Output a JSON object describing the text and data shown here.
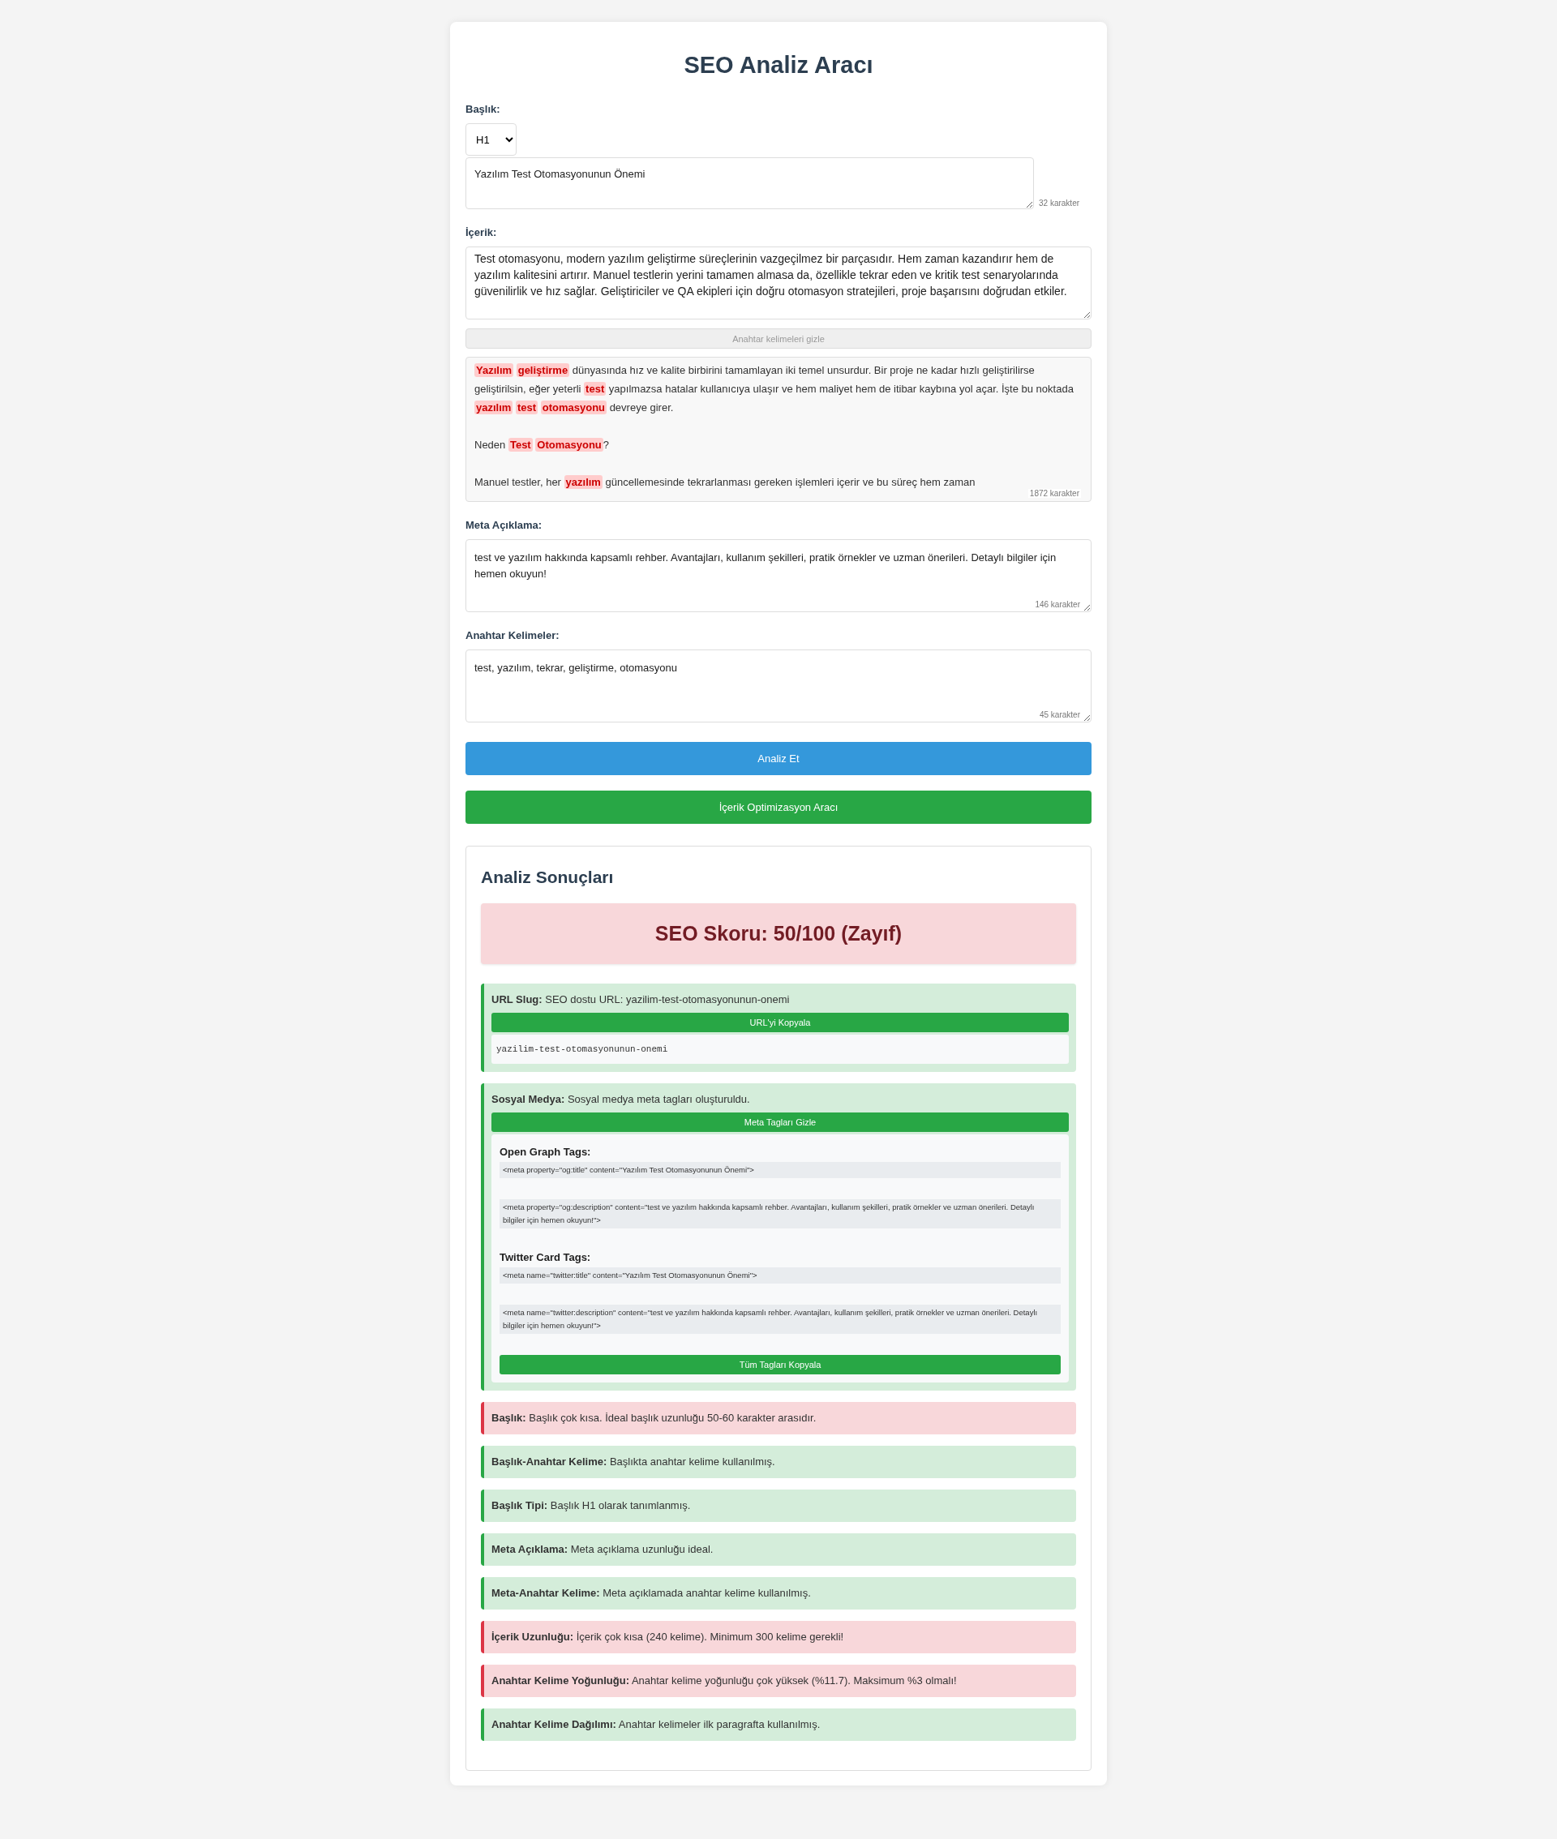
{
  "title": "SEO Analiz Aracı",
  "heading": {
    "label": "Başlık:",
    "level_select": "H1",
    "value": "Yazılım Test Otomasyonunun Önemi",
    "counter": "32 karakter"
  },
  "content": {
    "label": "İçerik:",
    "value": "Test otomasyonu, modern yazılım geliştirme süreçlerinin vazgeçilmez bir parçasıdır. Hem zaman kazandırır hem de yazılım kalitesini artırır. Manuel testlerin yerini tamamen almasa da, özellikle tekrar eden ve kritik test senaryolarında güvenilirlik ve hız sağlar. Geliştiriciler ve QA ekipleri için doğru otomasyon stratejileri, proje başarısını doğrudan etkiler.",
    "toggle_button": "Anahtar kelimeleri gizle",
    "preview": {
      "counter": "1872 karakter",
      "paragraphs": [
        [
          {
            "text": "Yazılım geliştirme",
            "highlighted": true
          },
          {
            "text": " dünyasında hız ve kalite birbirini tamamlayan iki temel unsurdur. Bir proje ne kadar hızlı geliştirilirse geliştirilsin, eğer yeterli ",
            "highlighted": false
          },
          {
            "text": "test",
            "highlighted": true
          },
          {
            "text": " yapılmazsa hatalar kullanıcıya ulaşır ve hem maliyet hem de itibar kaybına yol açar. İşte bu noktada ",
            "highlighted": false
          },
          {
            "text": "yazılım test otomasyonu",
            "highlighted": true
          },
          {
            "text": " devreye girer.",
            "highlighted": false
          }
        ],
        [
          {
            "text": "Neden ",
            "highlighted": false
          },
          {
            "text": "Test Otomasyonu",
            "highlighted": true
          },
          {
            "text": "?",
            "highlighted": false
          }
        ],
        [
          {
            "text": "Manuel testler, her ",
            "highlighted": false
          },
          {
            "text": "yazılım",
            "highlighted": true
          },
          {
            "text": " güncellemesinde tekrarlanması gereken işlemleri içerir ve bu süreç hem zaman",
            "highlighted": false
          }
        ]
      ]
    }
  },
  "meta": {
    "label": "Meta Açıklama:",
    "value": "test ve yazılım hakkında kapsamlı rehber. Avantajları, kullanım şekilleri, pratik örnekler ve uzman önerileri. Detaylı bilgiler için hemen okuyun!",
    "counter": "146 karakter"
  },
  "keywords": {
    "label": "Anahtar Kelimeler:",
    "value": "test, yazılım, tekrar, geliştirme, otomasyonu",
    "counter": "45 karakter"
  },
  "buttons": [
    {
      "label": "Analiz Et",
      "kind": "primary"
    },
    {
      "label": "İçerik Optimizasyon Aracı",
      "kind": "success"
    }
  ],
  "results": {
    "title": "Analiz Sonuçları",
    "score": {
      "text": "SEO Skoru: 50/100 (Zayıf)"
    },
    "items": [
      {
        "kind": "url",
        "color": "#28a745",
        "text": "**URL Slug:** SEO dostu URL: yazilim-test-otomasyonunun-onemi",
        "button": "URL'yi Kopyala",
        "code": "yazilim-test-otomasyonunun-onemi"
      },
      {
        "kind": "social",
        "color": "#28a745",
        "text": "**Sosyal Medya:** Sosyal medya meta tagları oluşturuldu.",
        "button": "Meta Tagları Gizle",
        "groups": [
          {
            "heading": "Open Graph Tags:",
            "tags": [
              "<meta property=\"og:title\" content=\"Yazılım Test Otomasyonunun Önemi\">",
              "<meta property=\"og:description\" content=\"test ve yazılım hakkında kapsamlı rehber. Avantajları, kullanım şekilleri, pratik örnekler ve uzman önerileri. Detaylı bilgiler için hemen okuyun!\">"
            ]
          },
          {
            "heading": "Twitter Card Tags:",
            "tags": [
              "<meta name=\"twitter:title\" content=\"Yazılım Test Otomasyonunun Önemi\">",
              "<meta name=\"twitter:description\" content=\"test ve yazılım hakkında kapsamlı rehber. Avantajları, kullanım şekilleri, pratik örnekler ve uzman önerileri. Detaylı bilgiler için hemen okuyun!\">"
            ]
          }
        ],
        "copy_all": "Tüm Tagları Kopyala"
      },
      {
        "kind": "plain",
        "color": "#dc3545",
        "text": "**Başlık:** Başlık çok kısa. İdeal başlık uzunluğu 50-60 karakter arasıdır."
      },
      {
        "kind": "plain",
        "color": "#28a745",
        "text": "**Başlık-Anahtar Kelime:** Başlıkta anahtar kelime kullanılmış."
      },
      {
        "kind": "plain",
        "color": "#28a745",
        "text": "**Başlık Tipi:** Başlık H1 olarak tanımlanmış."
      },
      {
        "kind": "plain",
        "color": "#28a745",
        "text": "**Meta Açıklama:** Meta açıklama uzunluğu ideal."
      },
      {
        "kind": "plain",
        "color": "#28a745",
        "text": "**Meta-Anahtar Kelime:** Meta açıklamada anahtar kelime kullanılmış."
      },
      {
        "kind": "plain",
        "color": "#dc3545",
        "text": "**İçerik Uzunluğu:** İçerik çok kısa (240 kelime). Minimum 300 kelime gerekli!"
      },
      {
        "kind": "plain",
        "color": "#dc3545",
        "text": "**Anahtar Kelime Yoğunluğu:** Anahtar kelime yoğunluğu çok yüksek (%11.7). Maksimum %3 olmalı!"
      },
      {
        "kind": "plain",
        "color": "#28a745",
        "text": "**Anahtar Kelime Dağılımı:** Anahtar kelimeler ilk paragrafta kullanılmış."
      }
    ]
  }
}
